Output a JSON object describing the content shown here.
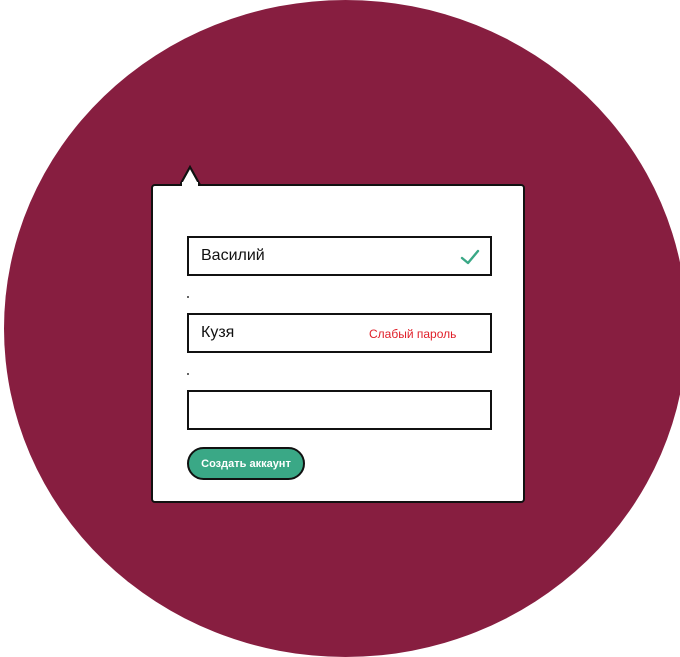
{
  "form": {
    "name_value": "Василий",
    "password_value": "Кузя",
    "password_error": "Слабый пароль",
    "confirm_value": "",
    "submit_label": "Создать аккаунт"
  },
  "icons": {
    "valid": "check-icon"
  },
  "colors": {
    "background_circle": "#871e40",
    "accent": "#3aa886",
    "error": "#e0202a"
  }
}
